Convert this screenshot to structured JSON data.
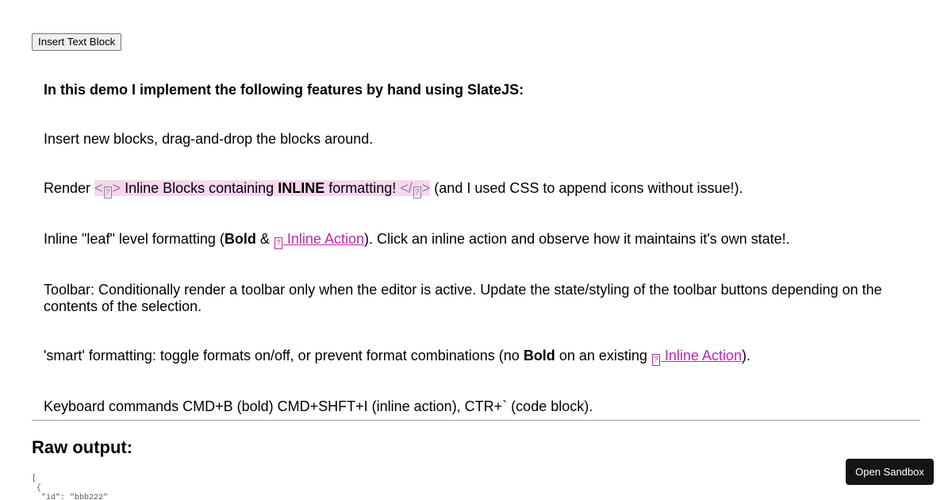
{
  "toolbar": {
    "insert_label": "Insert Text Block"
  },
  "editor": {
    "heading": "In this demo I implement the following features by hand using SlateJS:",
    "p1": "Insert new blocks, drag-and-drop the blocks around.",
    "p2": {
      "prefix": "Render ",
      "marker_open": "<",
      "marker_close": ">",
      "ib_text_before": " Inline Blocks containing ",
      "ib_bold": "INLINE",
      "ib_text_after": " formatting! ",
      "marker_slash_open": "</",
      "suffix": " (and I used CSS to append icons without issue!)."
    },
    "p3": {
      "prefix": "Inline \"leaf\" level formatting (",
      "bold": "Bold",
      "amp": " & ",
      "action": " Inline Action",
      "suffix": "). Click an inline action and observe how it maintains it's own state!."
    },
    "p4": "Toolbar: Conditionally render a toolbar only when the editor is active. Update the state/styling of the toolbar buttons depending on the contents of the selection.",
    "p5": {
      "prefix": "'smart' formatting: toggle formats on/off, or prevent format combinations (no ",
      "bold": "Bold",
      "middle": " on an existing ",
      "action": " Inline Action",
      "suffix": ")."
    },
    "p6": "Keyboard commands CMD+B (bold) CMD+SHFT+I (inline action), CTR+` (code block)."
  },
  "glyph": "?",
  "raw": {
    "title": "Raw output:",
    "code": "[\n {\n  \"id\": \"bbb222\""
  },
  "sandbox": {
    "label": "Open Sandbox"
  },
  "colors": {
    "inline_block_bg": "#f8d6f0",
    "inline_action": "#c026b0",
    "sandbox_bg": "#151515"
  }
}
